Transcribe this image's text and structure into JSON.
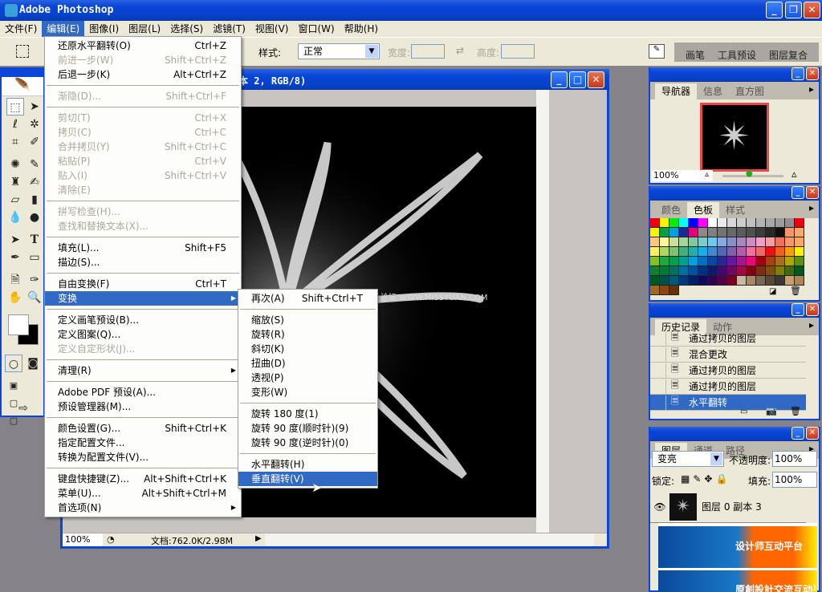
{
  "app": {
    "title": "Adobe Photoshop"
  },
  "menubar": [
    "文件(F)",
    "编辑(E)",
    "图像(I)",
    "图层(L)",
    "选择(S)",
    "滤镜(T)",
    "视图(V)",
    "窗口(W)",
    "帮助(H)"
  ],
  "options": {
    "style_label": "样式:",
    "style_value": "正常",
    "width_label": "宽度:",
    "height_label": "高度:",
    "palette_tabs": [
      "画笔",
      "工具预设",
      "图层复合"
    ]
  },
  "document": {
    "title": "本 2, RGB/8)",
    "zoom": "100%",
    "status": "文档:762.0K/2.98M",
    "watermark_text": "思缘设计论坛  WWW.MISSYUAN.COM"
  },
  "edit_menu": [
    {
      "label": "还原水平翻转(O)",
      "shortcut": "Ctrl+Z"
    },
    {
      "label": "前进一步(W)",
      "shortcut": "Shift+Ctrl+Z",
      "disabled": true
    },
    {
      "label": "后退一步(K)",
      "shortcut": "Alt+Ctrl+Z"
    },
    {
      "sep": true
    },
    {
      "label": "渐隐(D)...",
      "shortcut": "Shift+Ctrl+F",
      "disabled": true
    },
    {
      "sep": true
    },
    {
      "label": "剪切(T)",
      "shortcut": "Ctrl+X",
      "disabled": true
    },
    {
      "label": "拷贝(C)",
      "shortcut": "Ctrl+C",
      "disabled": true
    },
    {
      "label": "合并拷贝(Y)",
      "shortcut": "Shift+Ctrl+C",
      "disabled": true
    },
    {
      "label": "粘贴(P)",
      "shortcut": "Ctrl+V",
      "disabled": true
    },
    {
      "label": "贴入(I)",
      "shortcut": "Shift+Ctrl+V",
      "disabled": true
    },
    {
      "label": "清除(E)",
      "shortcut": "",
      "disabled": true
    },
    {
      "sep": true
    },
    {
      "label": "拼写检查(H)...",
      "shortcut": "",
      "disabled": true
    },
    {
      "label": "查找和替换文本(X)...",
      "shortcut": "",
      "disabled": true
    },
    {
      "sep": true
    },
    {
      "label": "填充(L)...",
      "shortcut": "Shift+F5"
    },
    {
      "label": "描边(S)...",
      "shortcut": ""
    },
    {
      "sep": true
    },
    {
      "label": "自由变换(F)",
      "shortcut": "Ctrl+T"
    },
    {
      "label": "变换",
      "shortcut": "",
      "submenu": true,
      "highlighted": true
    },
    {
      "sep": true
    },
    {
      "label": "定义画笔预设(B)...",
      "shortcut": ""
    },
    {
      "label": "定义图案(Q)...",
      "shortcut": ""
    },
    {
      "label": "定义自定形状(J)...",
      "shortcut": "",
      "disabled": true
    },
    {
      "sep": true
    },
    {
      "label": "清理(R)",
      "shortcut": "",
      "submenu": true
    },
    {
      "sep": true
    },
    {
      "label": "Adobe PDF 预设(A)...",
      "shortcut": ""
    },
    {
      "label": "预设管理器(M)...",
      "shortcut": ""
    },
    {
      "sep": true
    },
    {
      "label": "颜色设置(G)...",
      "shortcut": "Shift+Ctrl+K"
    },
    {
      "label": "指定配置文件...",
      "shortcut": ""
    },
    {
      "label": "转换为配置文件(V)...",
      "shortcut": ""
    },
    {
      "sep": true
    },
    {
      "label": "键盘快捷键(Z)...",
      "shortcut": "Alt+Shift+Ctrl+K"
    },
    {
      "label": "菜单(U)...",
      "shortcut": "Alt+Shift+Ctrl+M"
    },
    {
      "label": "首选项(N)",
      "shortcut": "",
      "submenu": true
    }
  ],
  "transform_menu": [
    {
      "label": "再次(A)",
      "shortcut": "Shift+Ctrl+T"
    },
    {
      "sep": true
    },
    {
      "label": "缩放(S)"
    },
    {
      "label": "旋转(R)"
    },
    {
      "label": "斜切(K)"
    },
    {
      "label": "扭曲(D)"
    },
    {
      "label": "透视(P)"
    },
    {
      "label": "变形(W)"
    },
    {
      "sep": true
    },
    {
      "label": "旋转 180 度(1)"
    },
    {
      "label": "旋转 90 度(顺时针)(9)"
    },
    {
      "label": "旋转 90 度(逆时针)(0)"
    },
    {
      "sep": true
    },
    {
      "label": "水平翻转(H)"
    },
    {
      "label": "垂直翻转(V)",
      "highlighted": true
    }
  ],
  "navigator": {
    "tabs": [
      "导航器",
      "信息",
      "直方图"
    ],
    "zoom": "100%",
    "slider_fraction": 0.5
  },
  "swatches": {
    "tabs": [
      "颜色",
      "色板",
      "样式"
    ],
    "colors": [
      "#ee0011",
      "#fff200",
      "#00ee00",
      "#00ffff",
      "#0000ff",
      "#ff00ff",
      "#ffffff",
      "#ebebeb",
      "#d8d8d8",
      "#cccccc",
      "#c0c0c0",
      "#b4b4b4",
      "#a8a8a8",
      "#9c9c9c",
      "#909090",
      "#ee0011",
      "#fff200",
      "#00a040",
      "#00a0e0",
      "#1a2a90",
      "#e0007a",
      "#8a8a8a",
      "#808080",
      "#747474",
      "#686868",
      "#5c5c5c",
      "#505050",
      "#3c3c3c",
      "#282828",
      "#101010",
      "#f4966a",
      "#f8ac6c",
      "#fcc880",
      "#fff899",
      "#c8e09a",
      "#a6d49a",
      "#80c8a0",
      "#7ccccc",
      "#70c8f0",
      "#88a8e0",
      "#8890c8",
      "#a888c0",
      "#c890c0",
      "#f0a0c8",
      "#f0a0a0",
      "#f07060",
      "#f49a6a",
      "#f8a860",
      "#fff060",
      "#b0d860",
      "#80c070",
      "#40b080",
      "#20b0b0",
      "#10b0e8",
      "#4088d0",
      "#5068b0",
      "#8060a8",
      "#b060a8",
      "#f070a0",
      "#f06868",
      "#ee1010",
      "#f06018",
      "#f8a000",
      "#fff000",
      "#88c020",
      "#20a840",
      "#00a050",
      "#00a090",
      "#00a0e0",
      "#0070c0",
      "#0848a0",
      "#282890",
      "#6818a0",
      "#a01890",
      "#e80878",
      "#a00010",
      "#a84010",
      "#a87018",
      "#b0a800",
      "#609010",
      "#108030",
      "#007838",
      "#007060",
      "#0070a0",
      "#0050a0",
      "#003080",
      "#101868",
      "#400870",
      "#700860",
      "#a00848",
      "#800010",
      "#783010",
      "#805010",
      "#808000",
      "#406810",
      "#005820",
      "#005820",
      "#005050",
      "#005878",
      "#003878",
      "#002060",
      "#100858",
      "#300050",
      "#500048",
      "#780020",
      "#c8b8a8",
      "#a88868",
      "#786858",
      "#584838",
      "#383838",
      "#c8a070",
      "#a88858",
      "#a06820",
      "#884810",
      "#683008"
    ]
  },
  "history": {
    "tabs": [
      "历史记录",
      "动作"
    ],
    "items": [
      {
        "label": "通过拷贝的图层"
      },
      {
        "label": "混合更改"
      },
      {
        "label": "通过拷贝的图层"
      },
      {
        "label": "通过拷贝的图层"
      },
      {
        "label": "水平翻转",
        "selected": true
      }
    ]
  },
  "layers": {
    "tabs": [
      "图层",
      "通道",
      "路径"
    ],
    "blend_mode": "变亮",
    "opacity_label": "不透明度:",
    "opacity": "100%",
    "lock_label": "锁定:",
    "fill_label": "填充:",
    "fill": "100%",
    "items": [
      {
        "name": "图层 0 副本 3",
        "visible": true
      }
    ]
  },
  "watermark": {
    "line1": "设计师互动平台",
    "line2": "原創設計交流互动平台"
  }
}
